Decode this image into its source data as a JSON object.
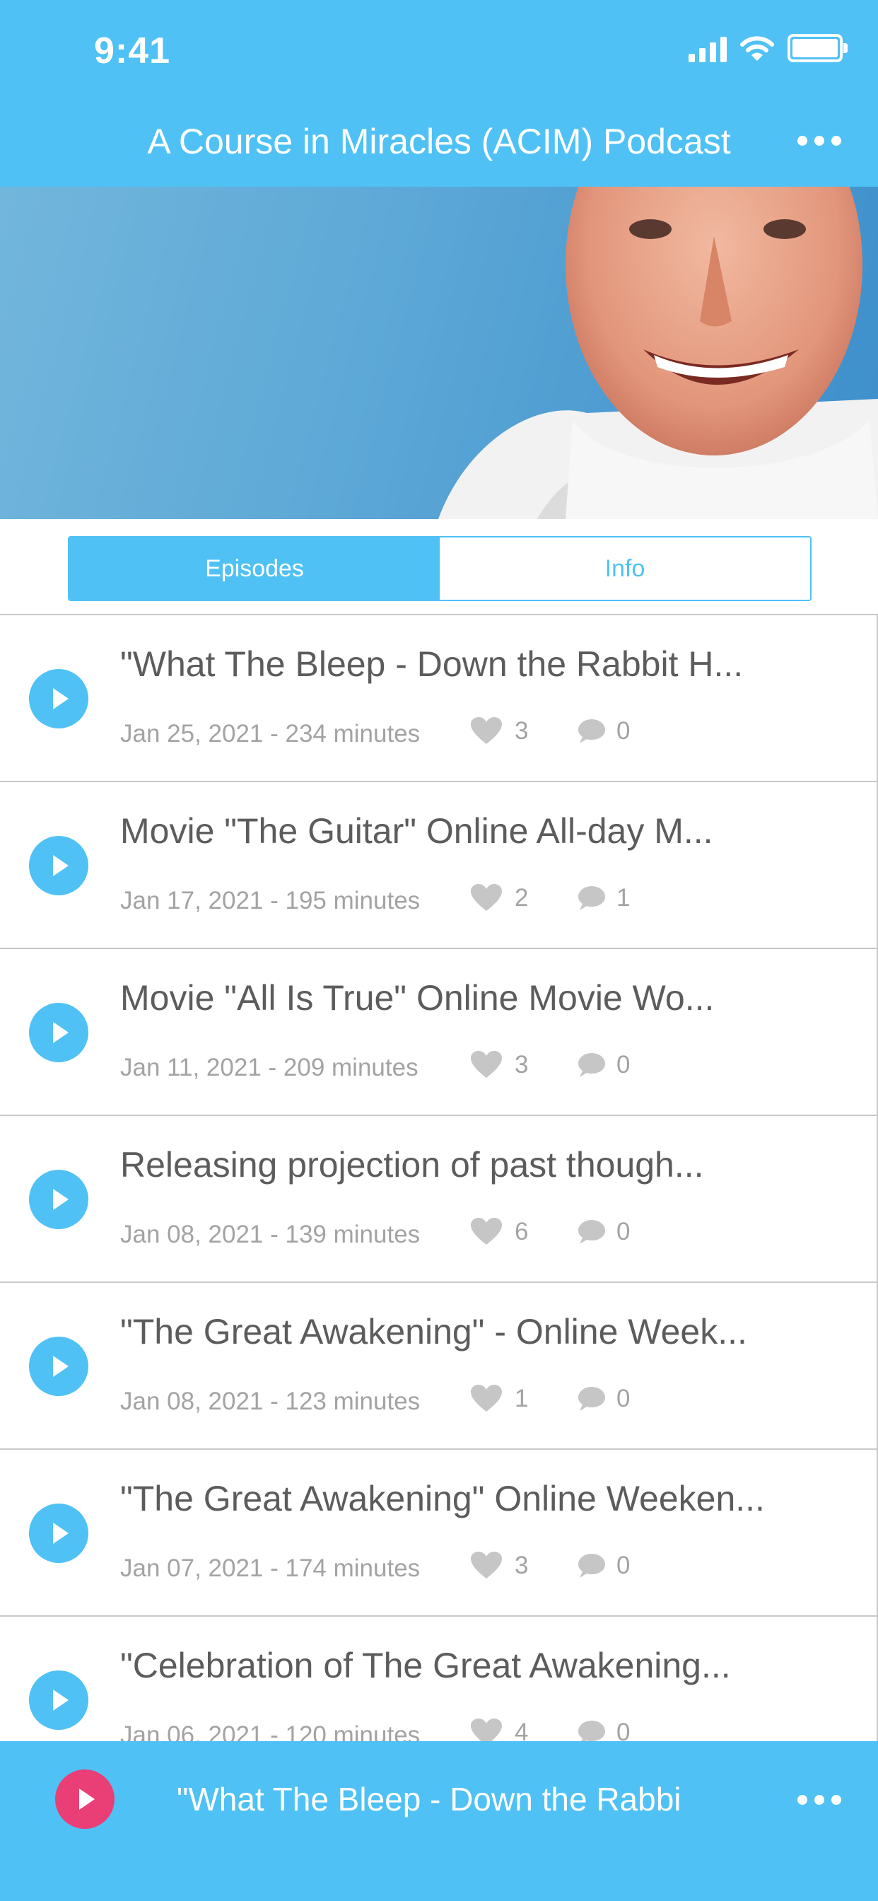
{
  "status_bar": {
    "time": "9:41"
  },
  "header": {
    "title": "A Course in Miracles (ACIM) Podcast"
  },
  "tabs": [
    {
      "label": "Episodes",
      "selected": true
    },
    {
      "label": "Info",
      "selected": false
    }
  ],
  "episodes": [
    {
      "title": "\"What The Bleep - Down the Rabbit H...",
      "meta": "Jan 25, 2021 - 234 minutes",
      "likes": "3",
      "comments": "0"
    },
    {
      "title": "Movie \"The Guitar\" Online All-day M...",
      "meta": "Jan 17, 2021 - 195 minutes",
      "likes": "2",
      "comments": "1"
    },
    {
      "title": "Movie \"All Is True\" Online Movie Wo...",
      "meta": "Jan 11, 2021 - 209 minutes",
      "likes": "3",
      "comments": "0"
    },
    {
      "title": "Releasing projection of past though...",
      "meta": "Jan 08, 2021 - 139 minutes",
      "likes": "6",
      "comments": "0"
    },
    {
      "title": "\"The Great Awakening\" - Online Week...",
      "meta": "Jan 08, 2021 - 123 minutes",
      "likes": "1",
      "comments": "0"
    },
    {
      "title": "\"The Great Awakening\" Online Weeken...",
      "meta": "Jan 07, 2021 - 174 minutes",
      "likes": "3",
      "comments": "0"
    },
    {
      "title": "\"Celebration of The Great Awakening...",
      "meta": "Jan 06, 2021 - 120 minutes",
      "likes": "4",
      "comments": "0"
    }
  ],
  "player": {
    "title": "\"What The Bleep - Down the Rabbi"
  },
  "colors": {
    "accent": "#4fc1f5",
    "play_accent": "#ea3e77",
    "text": "#5c5c5c",
    "meta": "#a3a3a3"
  }
}
